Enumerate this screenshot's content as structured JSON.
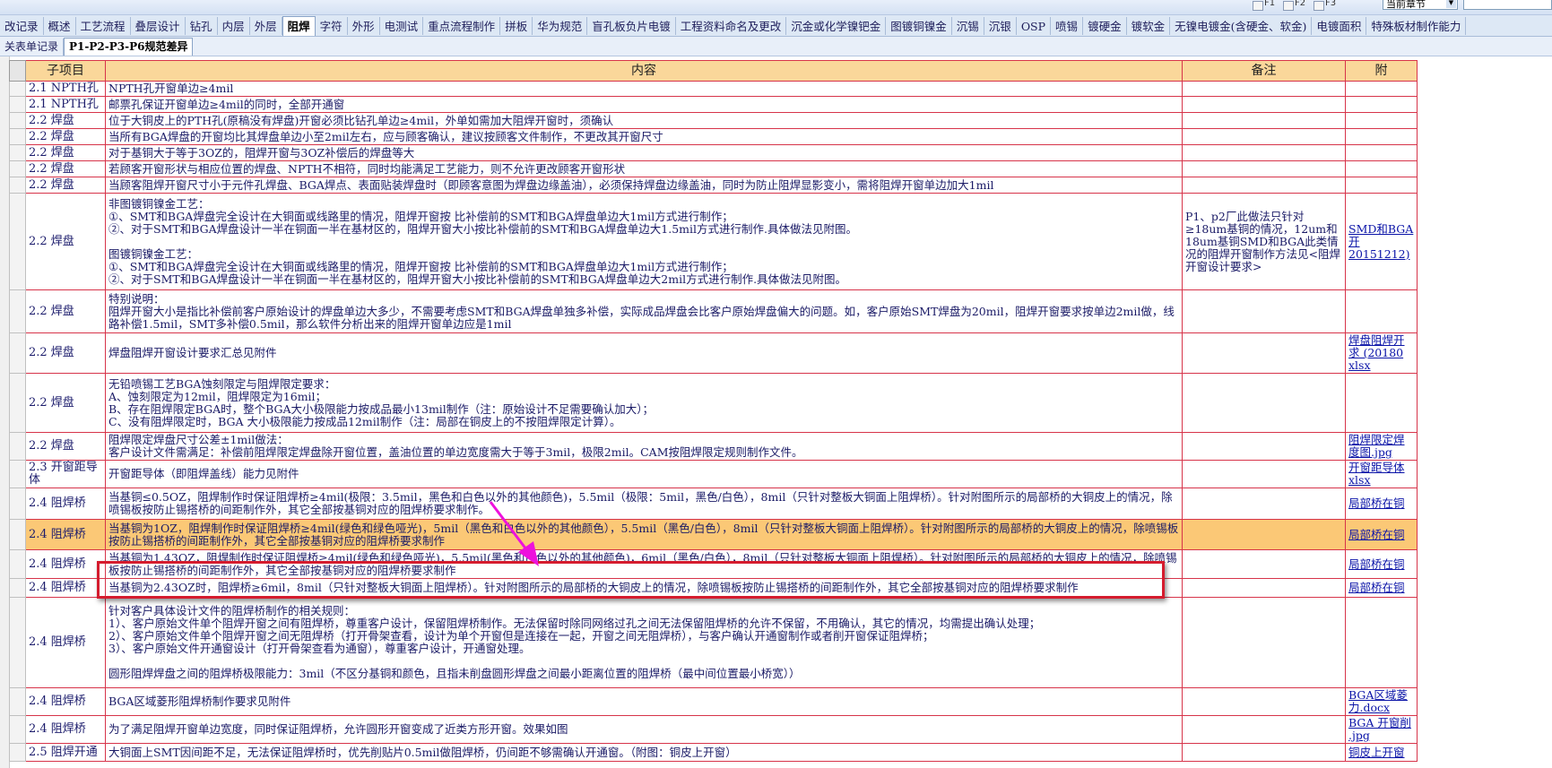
{
  "toolbar": {
    "f1": "F1",
    "f2": "F2",
    "f3": "F3",
    "scope_select": "当前章节"
  },
  "tabs_main": [
    "改记录",
    "概述",
    "工艺流程",
    "叠层设计",
    "钻孔",
    "内层",
    "外层",
    "阻焊",
    "字符",
    "外形",
    "电测试",
    "重点流程制作",
    "拼板",
    "华为规范",
    "盲孔板负片电镀",
    "工程资料命名及更改",
    "沉金或化学镍钯金",
    "图镀铜镍金",
    "沉锡",
    "沉银",
    "OSP",
    "喷锡",
    "镀硬金",
    "镀软金",
    "无镍电镀金(含硬金、软金)",
    "电镀面积",
    "特殊板材制作能力"
  ],
  "tabs_main_active": 7,
  "tabs_sub": [
    "关表单记录",
    "P1-P2-P3-P6规范差异"
  ],
  "tabs_sub_active": 1,
  "table": {
    "headers": {
      "item": "子项目",
      "content": "内容",
      "note": "备注",
      "attach": "附"
    },
    "rows": [
      {
        "item": "2.1 NPTH孔",
        "content": "NPTH孔开窗单边≥4mil",
        "note": "",
        "attach": ""
      },
      {
        "item": "2.1 NPTH孔",
        "content": "邮票孔保证开窗单边≥4mil的同时，全部开通窗",
        "note": "",
        "attach": ""
      },
      {
        "item": "2.2 焊盘",
        "content": "位于大铜皮上的PTH孔(原稿没有焊盘)开窗必须比钻孔单边≥4mil，外单如需加大阻焊开窗时，须确认",
        "note": "",
        "attach": ""
      },
      {
        "item": "2.2 焊盘",
        "content": "当所有BGA焊盘的开窗均比其焊盘单边小至2mil左右，应与顾客确认，建议按顾客文件制作，不更改其开窗尺寸",
        "note": "",
        "attach": ""
      },
      {
        "item": "2.2 焊盘",
        "content": "对于基铜大于等于3OZ的，阻焊开窗与3OZ补偿后的焊盘等大",
        "note": "",
        "attach": ""
      },
      {
        "item": "2.2 焊盘",
        "content": "若顾客开窗形状与相应位置的焊盘、NPTH不相符，同时均能满足工艺能力，则不允许更改顾客开窗形状",
        "note": "",
        "attach": ""
      },
      {
        "item": "2.2 焊盘",
        "content": "当顾客阻焊开窗尺寸小于元件孔焊盘、BGA焊点、表面贴装焊盘时（即顾客意图为焊盘边缘盖油），必须保持焊盘边缘盖油，同时为防止阻焊显影变小，需将阻焊开窗单边加大1mil",
        "note": "",
        "attach": ""
      },
      {
        "item": "2.2 焊盘",
        "content": "非图镀铜镍金工艺：\n①、SMT和BGA焊盘完全设计在大铜面或线路里的情况，阻焊开窗按 比补偿前的SMT和BGA焊盘单边大1mil方式进行制作；\n②、对于SMT和BGA焊盘设计一半在铜面一半在基材区的，阻焊开窗大小按比补偿前的SMT和BGA焊盘单边大1.5mil方式进行制作.具体做法见附图。\n\n图镀铜镍金工艺：\n①、SMT和BGA焊盘完全设计在大铜面或线路里的情况，阻焊开窗按 比补偿前的SMT和BGA焊盘单边大1mil方式进行制作；\n②、对于SMT和BGA焊盘设计一半在铜面一半在基材区的，阻焊开窗大小按比补偿前的SMT和BGA焊盘单边大2mil方式进行制作.具体做法见附图。",
        "note": "P1、p2厂此做法只针对≥18um基铜的情况，12um和18um基铜SMD和BGA此类情况的阻焊开窗制作方法见<阻焊开窗设计要求>",
        "attach": "SMD和BGA开\n20151212)"
      },
      {
        "item": "2.2 焊盘",
        "content": "特别说明：\n阻焊开窗大小是指比补偿前客户原始设计的焊盘单边大多少，不需要考虑SMT和BGA焊盘单独多补偿，实际成品焊盘会比客户原始焊盘偏大的问题。如，客户原始SMT焊盘为20mil，阻焊开窗要求按单边2mil做，线路补偿1.5mil，SMT多补偿0.5mil，那么软件分析出来的阻焊开窗单边应是1mil",
        "note": "",
        "attach": ""
      },
      {
        "item": "2.2 焊盘",
        "content": "焊盘阻焊开窗设计要求汇总见附件",
        "note": "",
        "attach": "焊盘阻焊开\n求 (20180\nxlsx"
      },
      {
        "item": "2.2 焊盘",
        "content": "无铅喷锡工艺BGA蚀刻限定与阻焊限定要求：\nA、蚀刻限定为12mil，阻焊限定为16mil；\nB、存在阻焊限定BGA时，整个BGA大小极限能力按成品最小13mil制作（注：原始设计不足需要确认加大）；\nC、没有阻焊限定时，BGA 大小极限能力按成品12mil制作（注：局部在铜皮上的不按阻焊限定计算）。",
        "note": "",
        "attach": ""
      },
      {
        "item": "2.2 焊盘",
        "content": "阻焊限定焊盘尺寸公差±1mil做法：\n客户设计文件需满足：补偿前阻焊限定焊盘除开窗位置，盖油位置的单边宽度需大于等于3mil，极限2mil。CAM按阻焊限定规则制作文件。",
        "note": "",
        "attach": "阻焊限定焊\n度图.jpg"
      },
      {
        "item": "2.3 开窗距导体",
        "content": "开窗距导体（即阻焊盖线）能力见附件",
        "note": "",
        "attach": "开窗距导体\nxlsx"
      },
      {
        "item": "2.4 阻焊桥",
        "content": "当基铜≤0.5OZ，阻焊制作时保证阻焊桥≥4mil(极限：3.5mil，黑色和白色以外的其他颜色)，5.5mil（极限：5mil，黑色/白色），8mil（只针对整板大铜面上阻焊桥）。针对附图所示的局部桥的大铜皮上的情况，除喷锡板按防止锡搭桥的间距制作外，其它全部按基铜对应的阻焊桥要求制作。",
        "note": "",
        "attach": "局部桥在铜"
      },
      {
        "item": "2.4 阻焊桥",
        "content": "当基铜为1OZ，阻焊制作时保证阻焊桥≥4mil(绿色和绿色哑光)，5mil（黑色和白色以外的其他颜色），5.5mil（黑色/白色），8mil（只针对整板大铜面上阻焊桥）。针对附图所示的局部桥的大铜皮上的情况，除喷锡板按防止锡搭桥的间距制作外，其它全部按基铜对应的阻焊桥要求制作",
        "note": "",
        "attach": "局部桥在铜"
      },
      {
        "item": "2.4 阻焊桥",
        "content": "当基铜为1.43OZ，阻焊制作时保证阻焊桥≥4mil(绿色和绿色哑光)，5.5mil(黑色和白色以外的其他颜色)，6mil（黑色/白色），8mil（只针对整板大铜面上阻焊桥）。针对附图所示的局部桥的大铜皮上的情况，除喷锡板按防止锡搭桥的间距制作外，其它全部按基铜对应的阻焊桥要求制作",
        "note": "",
        "attach": "局部桥在铜"
      },
      {
        "item": "2.4 阻焊桥",
        "content": "当基铜为2.43OZ时，阻焊桥≥6mil，8mil（只针对整板大铜面上阻焊桥）。针对附图所示的局部桥的大铜皮上的情况，除喷锡板按防止锡搭桥的间距制作外，其它全部按基铜对应的阻焊桥要求制作",
        "note": "",
        "attach": "局部桥在铜"
      },
      {
        "item": "2.4 阻焊桥",
        "content": "针对客户具体设计文件的阻焊桥制作的相关规则：\n1）、客户原始文件单个阻焊开窗之间有阻焊桥，尊重客户设计，保留阻焊桥制作。无法保留时除同网络过孔之间无法保留阻焊桥的允许不保留，不用确认，其它的情况，均需提出确认处理；\n2）、客户原始文件单个阻焊开窗之间无阻焊桥（打开骨架查看，设计为单个开窗但是连接在一起，开窗之间无阻焊桥），与客户确认开通窗制作或者削开窗保证阻焊桥；\n3）、客户原始文件开通窗设计（打开骨架查看为通窗），尊重客户设计，开通窗处理。\n\n圆形阻焊焊盘之间的阻焊桥极限能力：3mil（不区分基铜和颜色，且指未削盘圆形焊盘之间最小距离位置的阻焊桥（最中间位置最小桥宽））",
        "note": "",
        "attach": ""
      },
      {
        "item": "2.4 阻焊桥",
        "content": "BGA区域菱形阻焊桥制作要求见附件",
        "note": "",
        "attach": "BGA区域菱\n力.docx"
      },
      {
        "item": "2.4 阻焊桥",
        "content": "为了满足阻焊开窗单边宽度，同时保证阻焊桥，允许圆形开窗变成了近类方形开窗。效果如图",
        "note": "",
        "attach": "BGA 开窗削\n.jpg"
      },
      {
        "item": "2.5 阻焊开通",
        "content": "大铜面上SMT因间距不足，无法保证阻焊桥时，优先削贴片0.5mil做阻焊桥，仍间距不够需确认开通窗。（附图：铜皮上开窗）",
        "note": "",
        "attach": "铜皮上开窗"
      }
    ]
  }
}
